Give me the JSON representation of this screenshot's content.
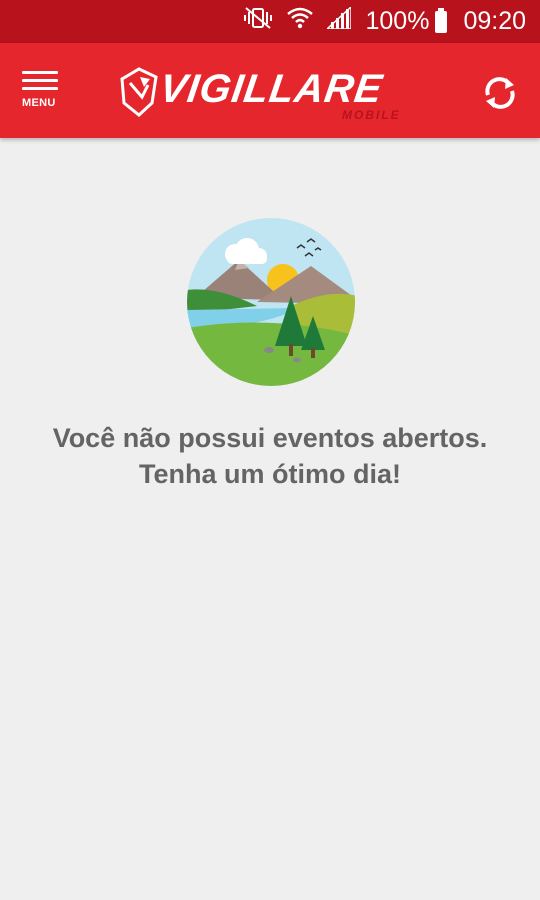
{
  "status_bar": {
    "battery_percent": "100%",
    "time": "09:20",
    "icons": [
      "mute-vibrate-icon",
      "wifi-icon",
      "signal-icon",
      "battery-icon"
    ]
  },
  "app_bar": {
    "menu_label": "MENU",
    "logo_text": "VIGILLARE",
    "logo_subtext": "MOBILE",
    "background_color": "#e6262d",
    "refresh_icon": "refresh-icon"
  },
  "empty_state": {
    "illustration": "landscape-illustration",
    "line1": "Você não possui eventos abertos.",
    "line2": "Tenha um ótimo dia!"
  }
}
